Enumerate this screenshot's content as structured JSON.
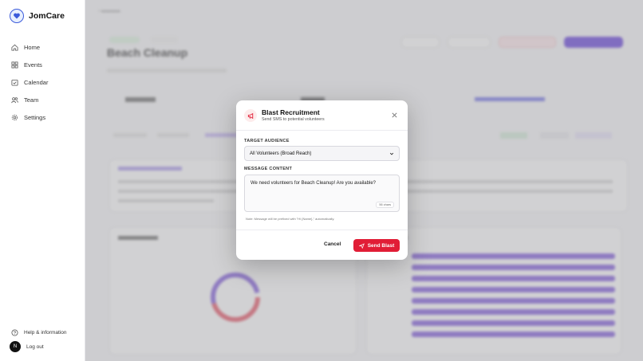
{
  "app": {
    "name": "JomCare"
  },
  "sidebar": {
    "items": [
      {
        "label": "Home",
        "icon": "home-icon"
      },
      {
        "label": "Events",
        "icon": "grid-icon"
      },
      {
        "label": "Calendar",
        "icon": "calendar-icon"
      },
      {
        "label": "Team",
        "icon": "users-icon"
      },
      {
        "label": "Settings",
        "icon": "gear-icon"
      }
    ],
    "help_label": "Help & information",
    "logout_label": "Log out",
    "avatar_initial": "N"
  },
  "background": {
    "page_title": "Beach Cleanup"
  },
  "modal": {
    "title": "Blast Recruitment",
    "subtitle": "Send SMS to potential volunteers",
    "audience_label": "TARGET AUDIENCE",
    "audience_value": "All Volunteers (Broad Reach)",
    "message_label": "MESSAGE CONTENT",
    "message_value": "We need volunteers for Beach Cleanup! Are you available?",
    "char_count": "56 chars",
    "note": "Note: Message will be prefixed with \"Hi {Name},\" automatically.",
    "cancel_label": "Cancel",
    "send_label": "Send Blast"
  },
  "colors": {
    "accent": "#e11d36",
    "brand": "#3b5bdb",
    "bars": "#6b3fd6"
  }
}
